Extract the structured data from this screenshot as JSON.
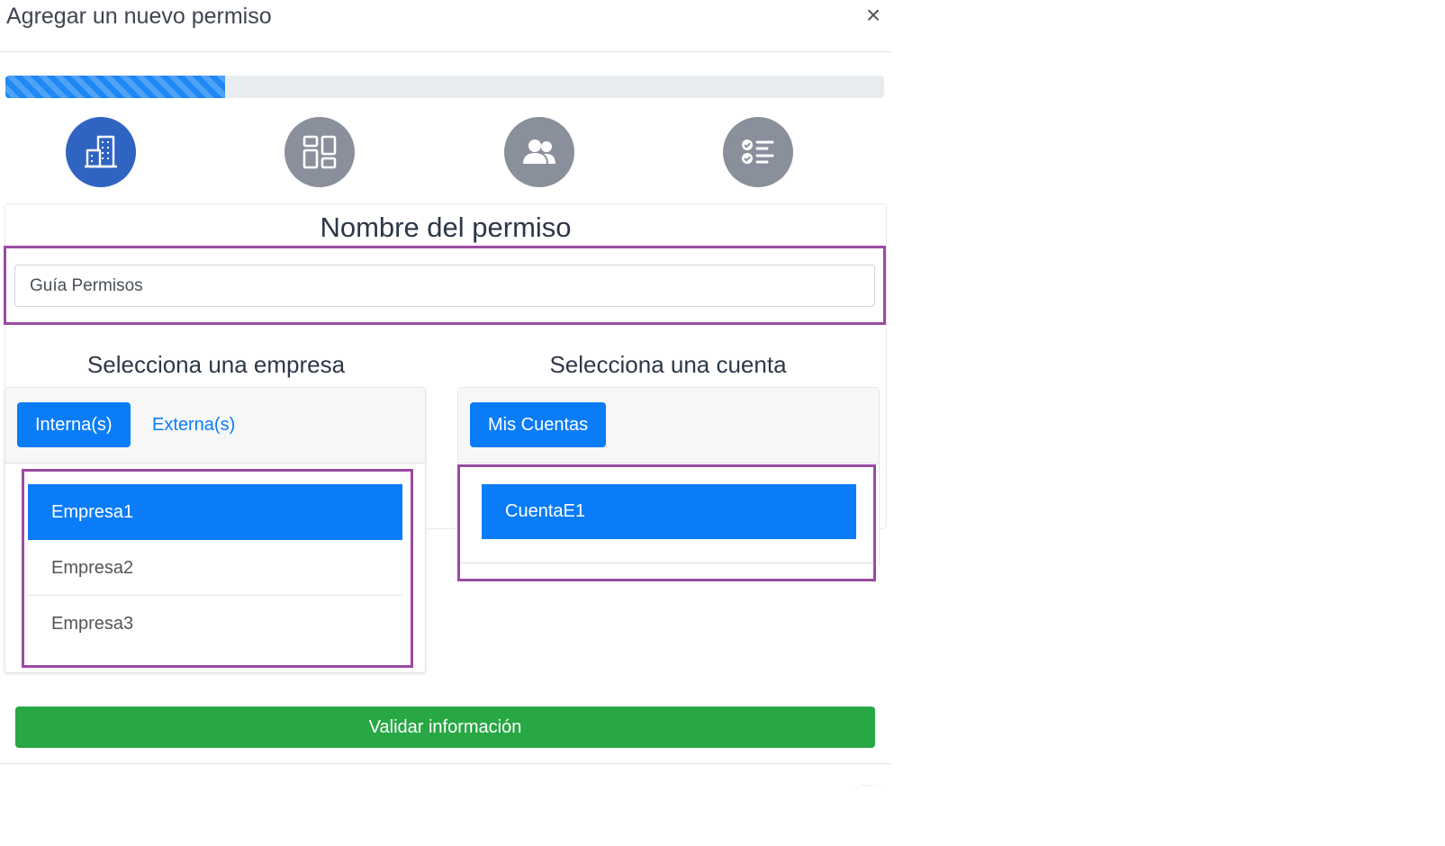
{
  "modal": {
    "title": "Agregar un nuevo permiso",
    "close_glyph": "×"
  },
  "progress": {
    "percent": 25,
    "color": "#1e88f5"
  },
  "steps": [
    {
      "icon": "building-icon",
      "active": true
    },
    {
      "icon": "dashboard-layout-icon",
      "active": false
    },
    {
      "icon": "users-icon",
      "active": false
    },
    {
      "icon": "checklist-icon",
      "active": false
    }
  ],
  "permission": {
    "heading": "Nombre del permiso",
    "input_value": "Guía Permisos"
  },
  "company_section": {
    "heading": "Selecciona una empresa",
    "tabs": [
      {
        "label": "Interna(s)",
        "active": true
      },
      {
        "label": "Externa(s)",
        "active": false
      }
    ],
    "items": [
      {
        "label": "Empresa1",
        "selected": true
      },
      {
        "label": "Empresa2",
        "selected": false
      },
      {
        "label": "Empresa3",
        "selected": false
      }
    ]
  },
  "account_section": {
    "heading": "Selecciona una cuenta",
    "tabs": [
      {
        "label": "Mis Cuentas",
        "active": true
      }
    ],
    "items": [
      {
        "label": "CuentaE1",
        "selected": true
      }
    ]
  },
  "footer": {
    "validate_label": "Validar información"
  },
  "colors": {
    "accent": "#0a7cf8",
    "step_active": "#2f64c3",
    "step_inactive": "#8a8f9c",
    "success": "#28a745",
    "highlight": "#9b4aa3"
  }
}
